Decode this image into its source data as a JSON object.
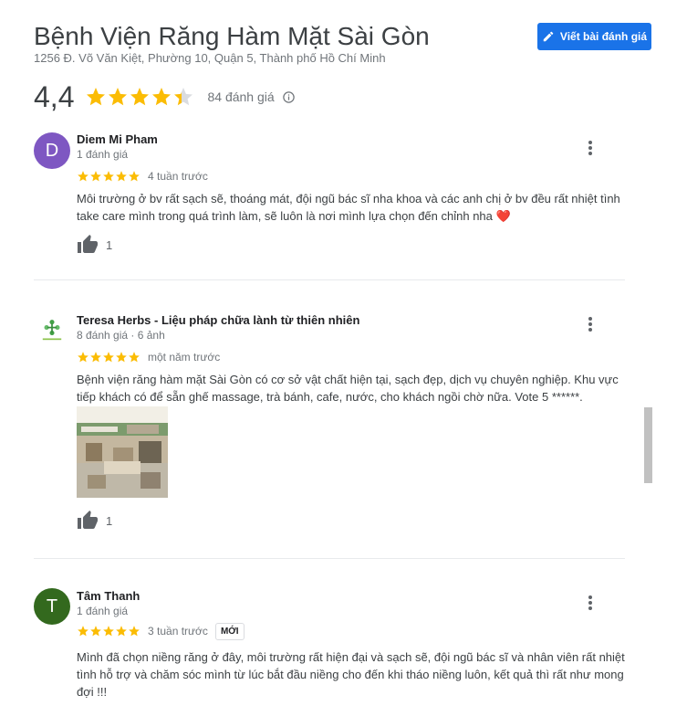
{
  "place": {
    "name": "Bệnh Viện Răng Hàm Mặt Sài Gòn",
    "address": "1256 Đ. Võ Văn Kiệt, Phường 10, Quận 5, Thành phố Hồ Chí Minh",
    "rating": "4,4",
    "rating_value": 4.4,
    "review_count": "84 đánh giá"
  },
  "actions": {
    "write_review": "Viết bài đánh giá"
  },
  "colors": {
    "accent": "#1a73e8",
    "star": "#fbbc04",
    "star_empty": "#dadce0"
  },
  "reviews": [
    {
      "avatar_letter": "D",
      "avatar_color": "#7e57c2",
      "author": "Diem Mi Pham",
      "meta": "1 đánh giá",
      "stars": 5,
      "time": "4 tuần trước",
      "text": "Môi trường ở bv rất sạch sẽ, thoáng mát, đội ngũ bác sĩ nha khoa và các anh chị ở bv đều rất nhiệt tình take care mình trong quá trình làm, sẽ luôn là nơi mình lựa chọn đến chỉnh nha ❤️",
      "likes": "1"
    },
    {
      "avatar_letter": "",
      "avatar_color": "#ffffff",
      "author": "Teresa Herbs - Liệu pháp chữa lành từ thiên nhiên",
      "meta": "8 đánh giá · 6 ảnh",
      "stars": 5,
      "time": "một năm trước",
      "text": "Bệnh viện răng hàm mặt Sài Gòn có cơ sở vật chất hiện tại,  sạch đẹp, dịch vụ chuyên nghiệp. Khu vực tiếp khách có để sẵn ghế massage, trà bánh, cafe, nước, cho khách ngồi chờ nữa. Vote 5 ******.",
      "likes": "1"
    },
    {
      "avatar_letter": "T",
      "avatar_color": "#33691e",
      "author": "Tâm Thanh",
      "meta": "1 đánh giá",
      "stars": 5,
      "time": "3 tuần trước",
      "badge": "MỚI",
      "text": "Mình đã chọn niềng răng ở đây, môi trường rất hiện đại và sạch sẽ, đội ngũ bác sĩ và nhân viên rất nhiệt tình hỗ trợ và chăm sóc mình từ lúc bắt đầu niềng cho đến khi tháo niềng luôn, kết quả thì rất như mong đợi !!!"
    }
  ]
}
